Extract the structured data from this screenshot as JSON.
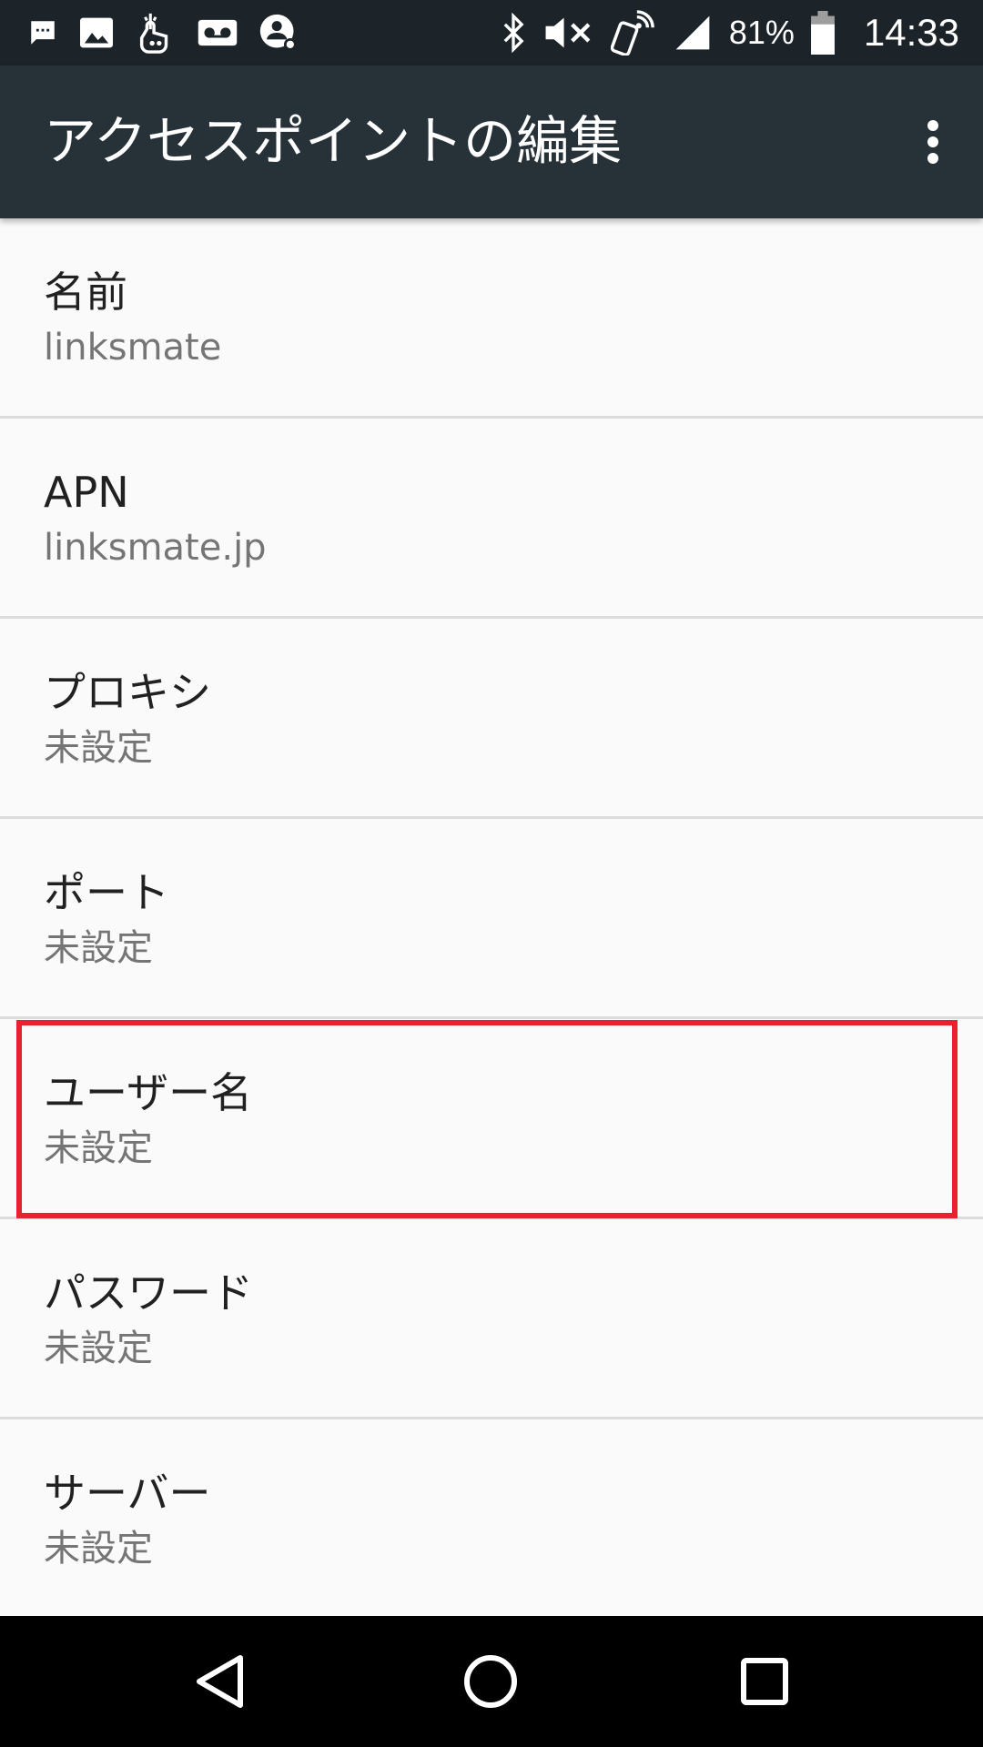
{
  "status_bar": {
    "battery": "81%",
    "time": "14:33",
    "left_icons": [
      "message-icon",
      "image-icon",
      "touch-app-icon",
      "voicemail-icon",
      "account-key-icon"
    ],
    "right_icons": [
      "bluetooth-icon",
      "volume-mute-icon",
      "phone-ring-icon",
      "signal-icon",
      "battery-icon"
    ]
  },
  "app_bar": {
    "title": "アクセスポイントの編集",
    "overflow_icon": "more-vert-icon",
    "background": "#263238"
  },
  "list": {
    "items": [
      {
        "title": "名前",
        "summary": "linksmate"
      },
      {
        "title": "APN",
        "summary": "linksmate.jp"
      },
      {
        "title": "プロキシ",
        "summary": "未設定"
      },
      {
        "title": "ポート",
        "summary": "未設定"
      },
      {
        "title": "ユーザー名",
        "summary": "未設定",
        "highlighted": true
      },
      {
        "title": "パスワード",
        "summary": "未設定"
      },
      {
        "title": "サーバー",
        "summary": "未設定"
      }
    ]
  },
  "highlight_color": "#e8212f",
  "nav_bar": {
    "buttons": [
      "back-icon",
      "home-icon",
      "recents-icon"
    ]
  }
}
